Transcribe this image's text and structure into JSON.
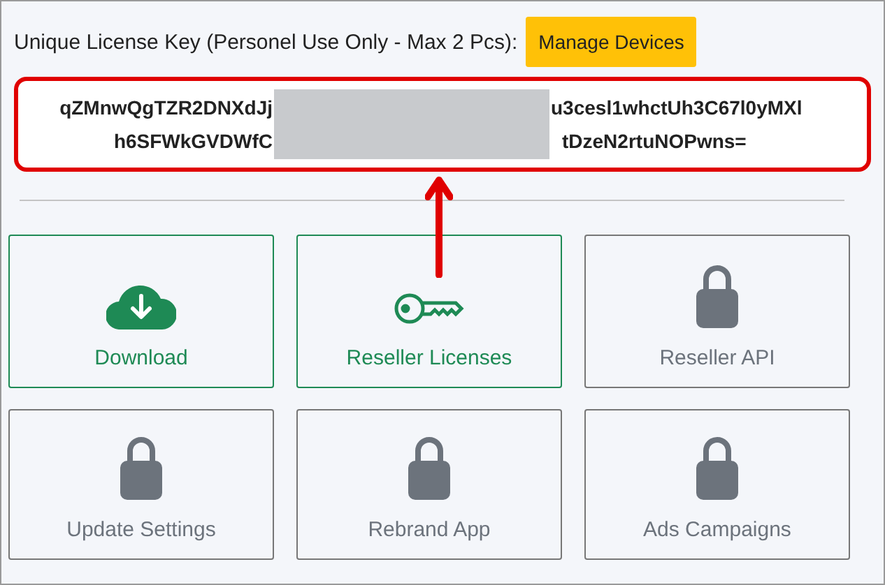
{
  "license": {
    "label": "Unique License Key (Personel Use Only - Max 2 Pcs):",
    "button": "Manage Devices",
    "key_lines": [
      {
        "before": "qZMnwQgTZR2DNXdJj",
        "after": "u3cesl1whctUh3C67l0yMXl"
      },
      {
        "before": "h6SFWkGVDWfC",
        "after": "tDzeN2rtuNOPwns="
      }
    ],
    "redacted": true
  },
  "cards": [
    {
      "label": "Download",
      "kind": "download",
      "locked": false
    },
    {
      "label": "Reseller Licenses",
      "kind": "key",
      "locked": false
    },
    {
      "label": "Reseller API",
      "kind": "lock",
      "locked": true
    },
    {
      "label": "Update Settings",
      "kind": "lock",
      "locked": true
    },
    {
      "label": "Rebrand App",
      "kind": "lock",
      "locked": true
    },
    {
      "label": "Ads Campaigns",
      "kind": "lock",
      "locked": true
    }
  ]
}
